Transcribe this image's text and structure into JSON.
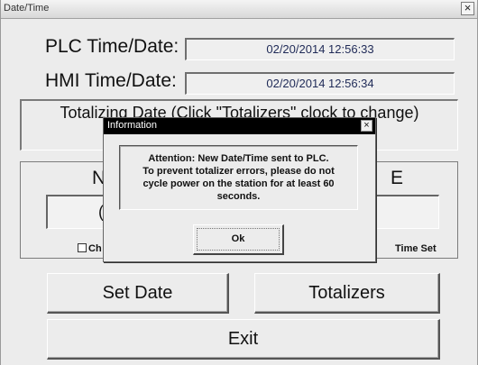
{
  "window": {
    "title": "Date/Time",
    "close_glyph": "×"
  },
  "plc": {
    "label": "PLC Time/Date:",
    "value": "02/20/2014 12:56:33"
  },
  "hmi": {
    "label": "HMI Time/Date:",
    "value": "02/20/2014 12:56:34"
  },
  "totalizing": {
    "text": "Totalizing Date   (Click \"Totalizers\" clock to change)"
  },
  "group": {
    "left_letter": "N",
    "right_letter": "E",
    "inner_letter": "(",
    "checkbox_label": "Ch",
    "right_status": "Time Set"
  },
  "buttons": {
    "set_date": "Set Date",
    "totalizers": "Totalizers",
    "exit": "Exit"
  },
  "dialog": {
    "title": "Information",
    "close_glyph": "×",
    "message_lines": [
      "Attention: New Date/Time sent to PLC.",
      "To prevent totalizer errors, please do not",
      "cycle power on the station for at least 60",
      "seconds."
    ],
    "ok_label": "Ok"
  }
}
